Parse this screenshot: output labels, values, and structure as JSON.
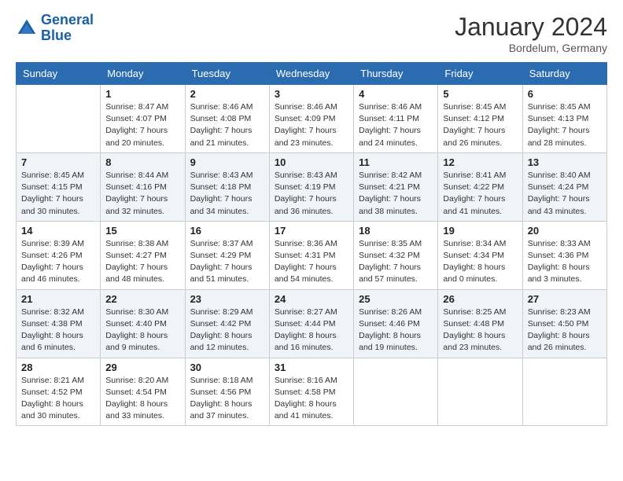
{
  "header": {
    "logo_line1": "General",
    "logo_line2": "Blue",
    "month_year": "January 2024",
    "location": "Bordelum, Germany"
  },
  "days_of_week": [
    "Sunday",
    "Monday",
    "Tuesday",
    "Wednesday",
    "Thursday",
    "Friday",
    "Saturday"
  ],
  "weeks": [
    [
      {
        "day": "",
        "sunrise": "",
        "sunset": "",
        "daylight": "",
        "empty": true
      },
      {
        "day": "1",
        "sunrise": "Sunrise: 8:47 AM",
        "sunset": "Sunset: 4:07 PM",
        "daylight": "Daylight: 7 hours and 20 minutes."
      },
      {
        "day": "2",
        "sunrise": "Sunrise: 8:46 AM",
        "sunset": "Sunset: 4:08 PM",
        "daylight": "Daylight: 7 hours and 21 minutes."
      },
      {
        "day": "3",
        "sunrise": "Sunrise: 8:46 AM",
        "sunset": "Sunset: 4:09 PM",
        "daylight": "Daylight: 7 hours and 23 minutes."
      },
      {
        "day": "4",
        "sunrise": "Sunrise: 8:46 AM",
        "sunset": "Sunset: 4:11 PM",
        "daylight": "Daylight: 7 hours and 24 minutes."
      },
      {
        "day": "5",
        "sunrise": "Sunrise: 8:45 AM",
        "sunset": "Sunset: 4:12 PM",
        "daylight": "Daylight: 7 hours and 26 minutes."
      },
      {
        "day": "6",
        "sunrise": "Sunrise: 8:45 AM",
        "sunset": "Sunset: 4:13 PM",
        "daylight": "Daylight: 7 hours and 28 minutes."
      }
    ],
    [
      {
        "day": "7",
        "sunrise": "Sunrise: 8:45 AM",
        "sunset": "Sunset: 4:15 PM",
        "daylight": "Daylight: 7 hours and 30 minutes."
      },
      {
        "day": "8",
        "sunrise": "Sunrise: 8:44 AM",
        "sunset": "Sunset: 4:16 PM",
        "daylight": "Daylight: 7 hours and 32 minutes."
      },
      {
        "day": "9",
        "sunrise": "Sunrise: 8:43 AM",
        "sunset": "Sunset: 4:18 PM",
        "daylight": "Daylight: 7 hours and 34 minutes."
      },
      {
        "day": "10",
        "sunrise": "Sunrise: 8:43 AM",
        "sunset": "Sunset: 4:19 PM",
        "daylight": "Daylight: 7 hours and 36 minutes."
      },
      {
        "day": "11",
        "sunrise": "Sunrise: 8:42 AM",
        "sunset": "Sunset: 4:21 PM",
        "daylight": "Daylight: 7 hours and 38 minutes."
      },
      {
        "day": "12",
        "sunrise": "Sunrise: 8:41 AM",
        "sunset": "Sunset: 4:22 PM",
        "daylight": "Daylight: 7 hours and 41 minutes."
      },
      {
        "day": "13",
        "sunrise": "Sunrise: 8:40 AM",
        "sunset": "Sunset: 4:24 PM",
        "daylight": "Daylight: 7 hours and 43 minutes."
      }
    ],
    [
      {
        "day": "14",
        "sunrise": "Sunrise: 8:39 AM",
        "sunset": "Sunset: 4:26 PM",
        "daylight": "Daylight: 7 hours and 46 minutes."
      },
      {
        "day": "15",
        "sunrise": "Sunrise: 8:38 AM",
        "sunset": "Sunset: 4:27 PM",
        "daylight": "Daylight: 7 hours and 48 minutes."
      },
      {
        "day": "16",
        "sunrise": "Sunrise: 8:37 AM",
        "sunset": "Sunset: 4:29 PM",
        "daylight": "Daylight: 7 hours and 51 minutes."
      },
      {
        "day": "17",
        "sunrise": "Sunrise: 8:36 AM",
        "sunset": "Sunset: 4:31 PM",
        "daylight": "Daylight: 7 hours and 54 minutes."
      },
      {
        "day": "18",
        "sunrise": "Sunrise: 8:35 AM",
        "sunset": "Sunset: 4:32 PM",
        "daylight": "Daylight: 7 hours and 57 minutes."
      },
      {
        "day": "19",
        "sunrise": "Sunrise: 8:34 AM",
        "sunset": "Sunset: 4:34 PM",
        "daylight": "Daylight: 8 hours and 0 minutes."
      },
      {
        "day": "20",
        "sunrise": "Sunrise: 8:33 AM",
        "sunset": "Sunset: 4:36 PM",
        "daylight": "Daylight: 8 hours and 3 minutes."
      }
    ],
    [
      {
        "day": "21",
        "sunrise": "Sunrise: 8:32 AM",
        "sunset": "Sunset: 4:38 PM",
        "daylight": "Daylight: 8 hours and 6 minutes."
      },
      {
        "day": "22",
        "sunrise": "Sunrise: 8:30 AM",
        "sunset": "Sunset: 4:40 PM",
        "daylight": "Daylight: 8 hours and 9 minutes."
      },
      {
        "day": "23",
        "sunrise": "Sunrise: 8:29 AM",
        "sunset": "Sunset: 4:42 PM",
        "daylight": "Daylight: 8 hours and 12 minutes."
      },
      {
        "day": "24",
        "sunrise": "Sunrise: 8:27 AM",
        "sunset": "Sunset: 4:44 PM",
        "daylight": "Daylight: 8 hours and 16 minutes."
      },
      {
        "day": "25",
        "sunrise": "Sunrise: 8:26 AM",
        "sunset": "Sunset: 4:46 PM",
        "daylight": "Daylight: 8 hours and 19 minutes."
      },
      {
        "day": "26",
        "sunrise": "Sunrise: 8:25 AM",
        "sunset": "Sunset: 4:48 PM",
        "daylight": "Daylight: 8 hours and 23 minutes."
      },
      {
        "day": "27",
        "sunrise": "Sunrise: 8:23 AM",
        "sunset": "Sunset: 4:50 PM",
        "daylight": "Daylight: 8 hours and 26 minutes."
      }
    ],
    [
      {
        "day": "28",
        "sunrise": "Sunrise: 8:21 AM",
        "sunset": "Sunset: 4:52 PM",
        "daylight": "Daylight: 8 hours and 30 minutes."
      },
      {
        "day": "29",
        "sunrise": "Sunrise: 8:20 AM",
        "sunset": "Sunset: 4:54 PM",
        "daylight": "Daylight: 8 hours and 33 minutes."
      },
      {
        "day": "30",
        "sunrise": "Sunrise: 8:18 AM",
        "sunset": "Sunset: 4:56 PM",
        "daylight": "Daylight: 8 hours and 37 minutes."
      },
      {
        "day": "31",
        "sunrise": "Sunrise: 8:16 AM",
        "sunset": "Sunset: 4:58 PM",
        "daylight": "Daylight: 8 hours and 41 minutes."
      },
      {
        "day": "",
        "sunrise": "",
        "sunset": "",
        "daylight": "",
        "empty": true
      },
      {
        "day": "",
        "sunrise": "",
        "sunset": "",
        "daylight": "",
        "empty": true
      },
      {
        "day": "",
        "sunrise": "",
        "sunset": "",
        "daylight": "",
        "empty": true
      }
    ]
  ]
}
